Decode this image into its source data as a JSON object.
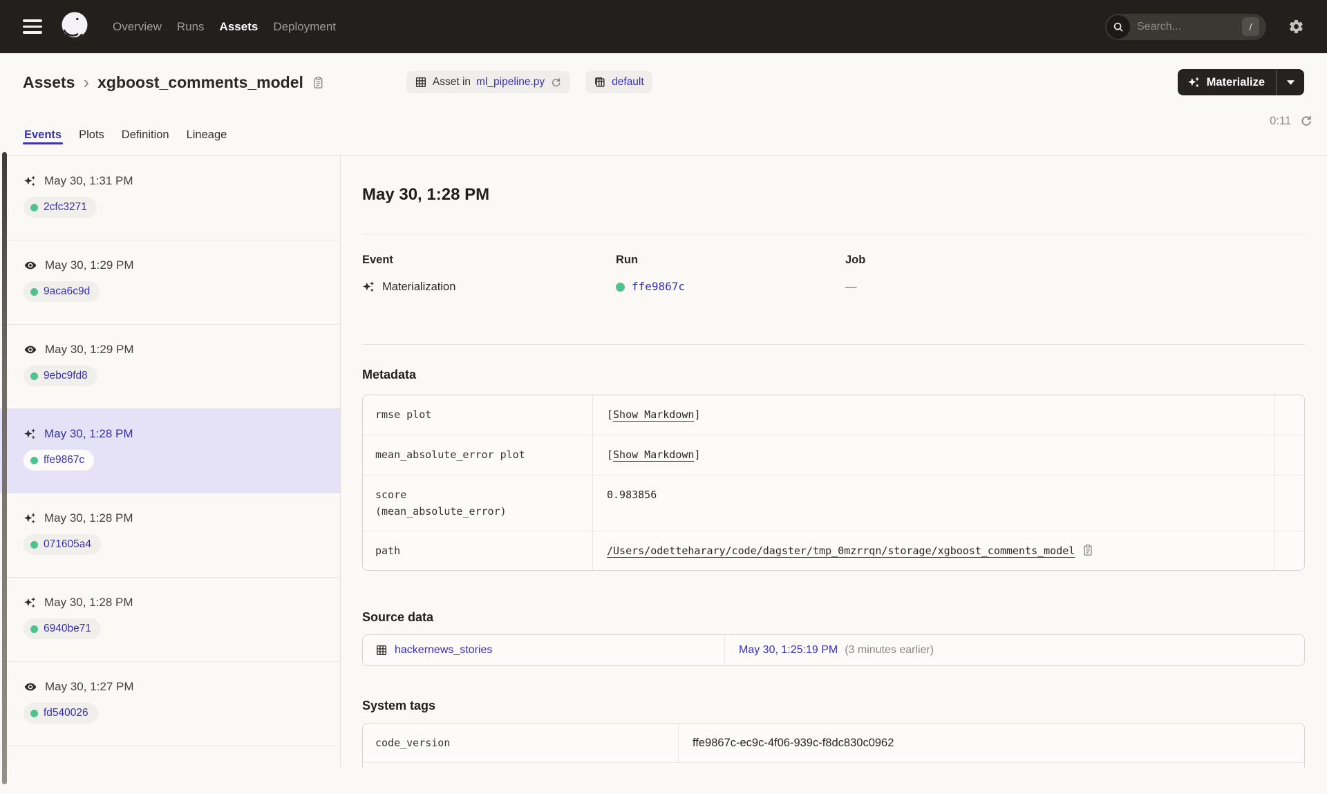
{
  "nav": {
    "links": [
      {
        "label": "Overview",
        "active": false
      },
      {
        "label": "Runs",
        "active": false
      },
      {
        "label": "Assets",
        "active": true
      },
      {
        "label": "Deployment",
        "active": false
      }
    ],
    "search_placeholder": "Search...",
    "search_shortcut": "/"
  },
  "header": {
    "breadcrumb_parent": "Assets",
    "breadcrumb_separator": "›",
    "breadcrumb_current": "xgboost_comments_model",
    "asset_in_prefix": "Asset in",
    "asset_in_link": "ml_pipeline.py",
    "group_badge": "default",
    "materialize_label": "Materialize"
  },
  "tabs": [
    {
      "label": "Events",
      "active": true
    },
    {
      "label": "Plots",
      "active": false
    },
    {
      "label": "Definition",
      "active": false
    },
    {
      "label": "Lineage",
      "active": false
    }
  ],
  "auto_refresh_timer": "0:11",
  "events": [
    {
      "type": "materialization",
      "time": "May 30, 1:31 PM",
      "run_id": "2cfc3271",
      "selected": false
    },
    {
      "type": "observation",
      "time": "May 30, 1:29 PM",
      "run_id": "9aca6c9d",
      "selected": false
    },
    {
      "type": "observation",
      "time": "May 30, 1:29 PM",
      "run_id": "9ebc9fd8",
      "selected": false
    },
    {
      "type": "materialization",
      "time": "May 30, 1:28 PM",
      "run_id": "ffe9867c",
      "selected": true
    },
    {
      "type": "materialization",
      "time": "May 30, 1:28 PM",
      "run_id": "071605a4",
      "selected": false
    },
    {
      "type": "materialization",
      "time": "May 30, 1:28 PM",
      "run_id": "6940be71",
      "selected": false
    },
    {
      "type": "observation",
      "time": "May 30, 1:27 PM",
      "run_id": "fd540026",
      "selected": false
    }
  ],
  "detail": {
    "title": "May 30, 1:28 PM",
    "event_label": "Event",
    "event_value": "Materialization",
    "run_label": "Run",
    "run_value": "ffe9867c",
    "job_label": "Job",
    "job_value": "—",
    "metadata_heading": "Metadata",
    "metadata_rows": [
      {
        "key": "rmse plot",
        "kind": "markdown",
        "bracket_open": "[",
        "value": "Show Markdown",
        "bracket_close": "]"
      },
      {
        "key": "mean_absolute_error plot",
        "kind": "markdown",
        "bracket_open": "[",
        "value": "Show Markdown",
        "bracket_close": "]"
      },
      {
        "key": "score\n(mean_absolute_error)",
        "kind": "text",
        "value": "0.983856"
      },
      {
        "key": "path",
        "kind": "path",
        "value": "/Users/odetteharary/code/dagster/tmp_0mzrrqn/storage/xgboost_comments_model"
      }
    ],
    "source_heading": "Source data",
    "source_rows": [
      {
        "asset": "hackernews_stories",
        "time": "May 30, 1:25:19 PM",
        "note": "(3 minutes earlier)"
      }
    ],
    "tags_heading": "System tags",
    "tags_rows": [
      {
        "key": "code_version",
        "value": "ffe9867c-ec9c-4f06-939c-f8dc830c0962"
      }
    ]
  },
  "colors": {
    "nav_background": "#231f1d",
    "page_background": "#faf9f6",
    "accent_indigo": "#372fb7",
    "selected_row_background": "#e5e2f8",
    "success_green": "#4fc38d",
    "muted_gray": "#8c8882"
  }
}
